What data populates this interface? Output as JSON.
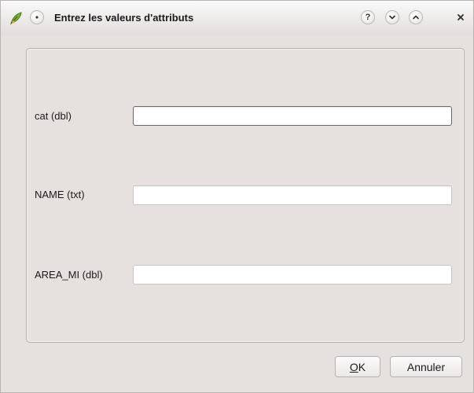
{
  "window": {
    "title": "Entrez les valeurs d'attributs",
    "icons": {
      "app": "qgis-leaf-icon",
      "menu": "window-menu-icon",
      "help": "help-icon",
      "minimize": "minimize-icon",
      "maximize": "maximize-icon",
      "close": "close-icon"
    },
    "help_glyph": "?"
  },
  "fields": [
    {
      "label": "cat (dbl)",
      "value": ""
    },
    {
      "label": "NAME (txt)",
      "value": ""
    },
    {
      "label": "AREA_MI (dbl)",
      "value": ""
    }
  ],
  "buttons": {
    "ok": {
      "mnemonic": "O",
      "rest": "K"
    },
    "cancel": "Annuler"
  },
  "colors": {
    "window_bg": "#e6e0de",
    "input_bg": "#ffffff",
    "focus_border": "#6b6866"
  }
}
